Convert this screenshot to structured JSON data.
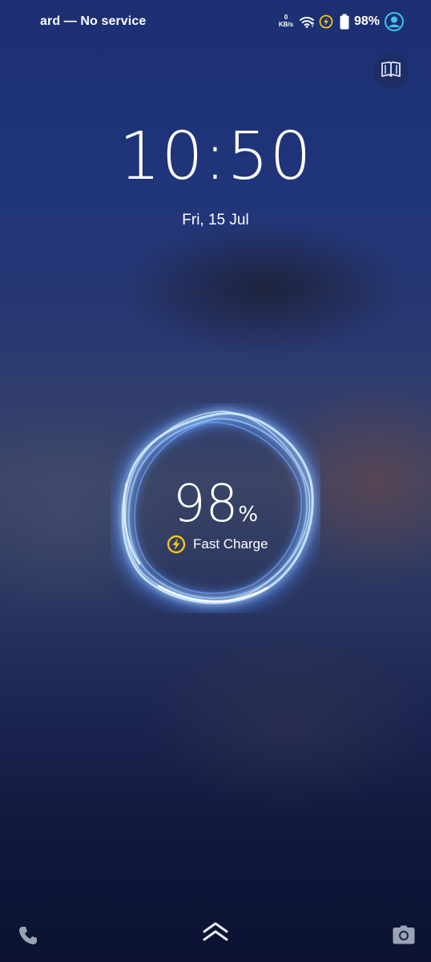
{
  "status_bar": {
    "carrier_text": "ard — No service",
    "net_speed_value": "0",
    "net_speed_unit": "KB/s",
    "battery_percent": "98%",
    "icons": [
      "wifi-icon",
      "fast-charge-icon",
      "battery-icon",
      "account-icon"
    ]
  },
  "lock_screen": {
    "time": "10:50",
    "date": "Fri, 15 Jul"
  },
  "charging": {
    "percent": "98",
    "percent_symbol": "%",
    "label": "Fast Charge",
    "level": 0.98
  },
  "shortcuts": {
    "left": "phone-icon",
    "center": "swipe-up-icon",
    "right": "camera-icon",
    "top_right": "book-icon"
  },
  "colors": {
    "accent_charge": "#f5c518",
    "ring_glow": "#9fd0ff",
    "account": "#41c4f0"
  }
}
